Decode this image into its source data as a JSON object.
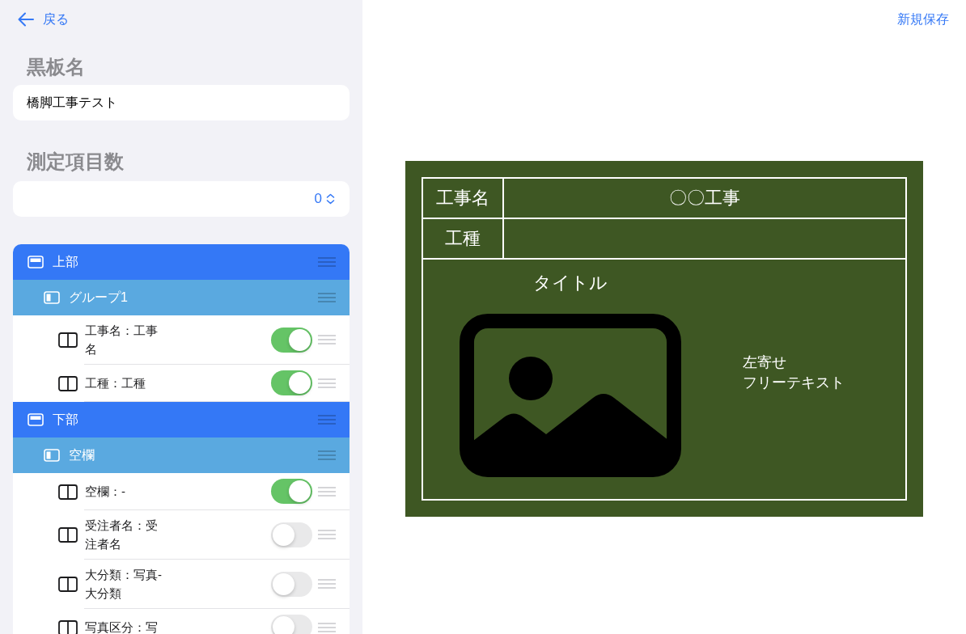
{
  "top_bar": {
    "back_label": "戻る",
    "save_label": "新規保存"
  },
  "form": {
    "board_name": {
      "heading": "黒板名",
      "value": "橋脚工事テスト"
    },
    "measure_count": {
      "heading": "測定項目数",
      "value": "0"
    }
  },
  "layout_tree": [
    {
      "label": "上部",
      "children": [
        {
          "label": "グループ1",
          "children": [
            {
              "label": "工事名：工事名",
              "on": true
            },
            {
              "label": "工種：工種",
              "on": true
            }
          ]
        }
      ]
    },
    {
      "label": "下部",
      "children": [
        {
          "label": "空欄",
          "children": [
            {
              "label": "空欄：-",
              "on": true
            },
            {
              "label": "受注者名：受注者名",
              "on": false
            },
            {
              "label": "大分類：写真-大分類",
              "on": false
            },
            {
              "label": "写真区分：写",
              "on": false
            }
          ]
        }
      ]
    }
  ],
  "blackboard": {
    "rows": [
      {
        "label": "工事名",
        "value": "〇〇工事"
      },
      {
        "label": "工種"
      }
    ],
    "title": "タイトル",
    "free_text_lines": [
      "左寄せ",
      "フリーテキスト"
    ]
  }
}
